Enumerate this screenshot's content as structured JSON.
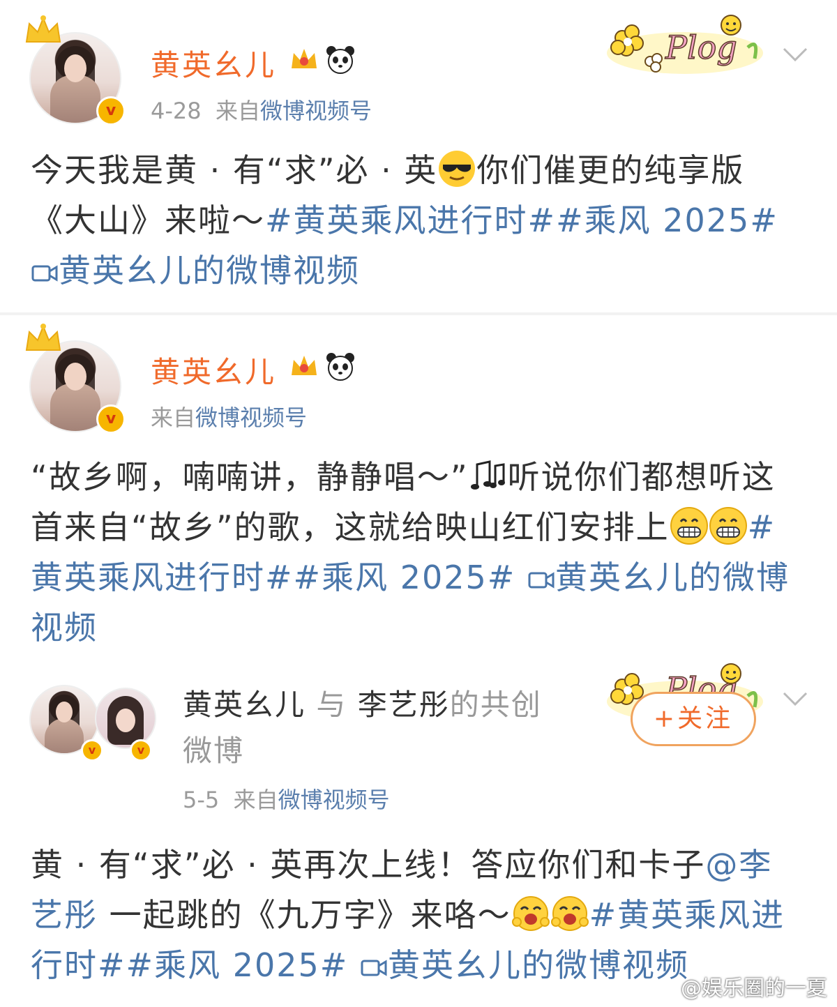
{
  "post1": {
    "author": "黄英幺儿",
    "date": "4-28",
    "source_prefix": "来自",
    "source": "微博视频号",
    "text_a": "今天我是黄 · 有“求”必 · 英",
    "text_b": "你们催更的纯享版《大山》来啦～",
    "hashtag1": "#黄英乘风进行时#",
    "hashtag2": "#乘风 2025#",
    "video_link": "黄英幺儿的微博视频"
  },
  "post2": {
    "author": "黄英幺儿",
    "source_prefix": "来自",
    "source": "微博视频号",
    "text_a": "“故乡啊，喃喃讲，静静唱～”",
    "text_b": "听说你们都想听这首来自“故乡”的歌，这就给映山红们安排上",
    "hashtag1": "#黄英乘风进行时#",
    "hashtag2": "#乘风 2025#",
    "video_link": "黄英幺儿的微博视频"
  },
  "post3": {
    "author": "黄英幺儿",
    "with": "与",
    "coauthor": "李艺彤",
    "co_suffix": "的共创",
    "co_suffix2": "微博",
    "follow_label": "+关注",
    "date": "5-5",
    "source_prefix": "来自",
    "source": "微博视频号",
    "text_a": "黄 · 有“求”必 · 英再次上线！答应你们和卡子",
    "mention": "@李艺彤",
    "text_b": " 一起跳的《九万字》来咯～",
    "hashtag1": "#黄英乘风进行时#",
    "hashtag2": "#乘风 2025#",
    "video_link": "黄英幺儿的微博视频"
  },
  "icons": {
    "crown": "crown-icon",
    "vip": "vip-crown-icon",
    "panda": "panda-icon",
    "verified": "verified-v-icon",
    "chevron": "chevron-down-icon",
    "video": "video-icon",
    "plog": "plog-sticker"
  },
  "colors": {
    "name": "#f06a2b",
    "link": "#4a76aa",
    "meta": "#9a9a9a"
  },
  "plog_text": "Plog",
  "watermark": "@娱乐圈的一夏"
}
